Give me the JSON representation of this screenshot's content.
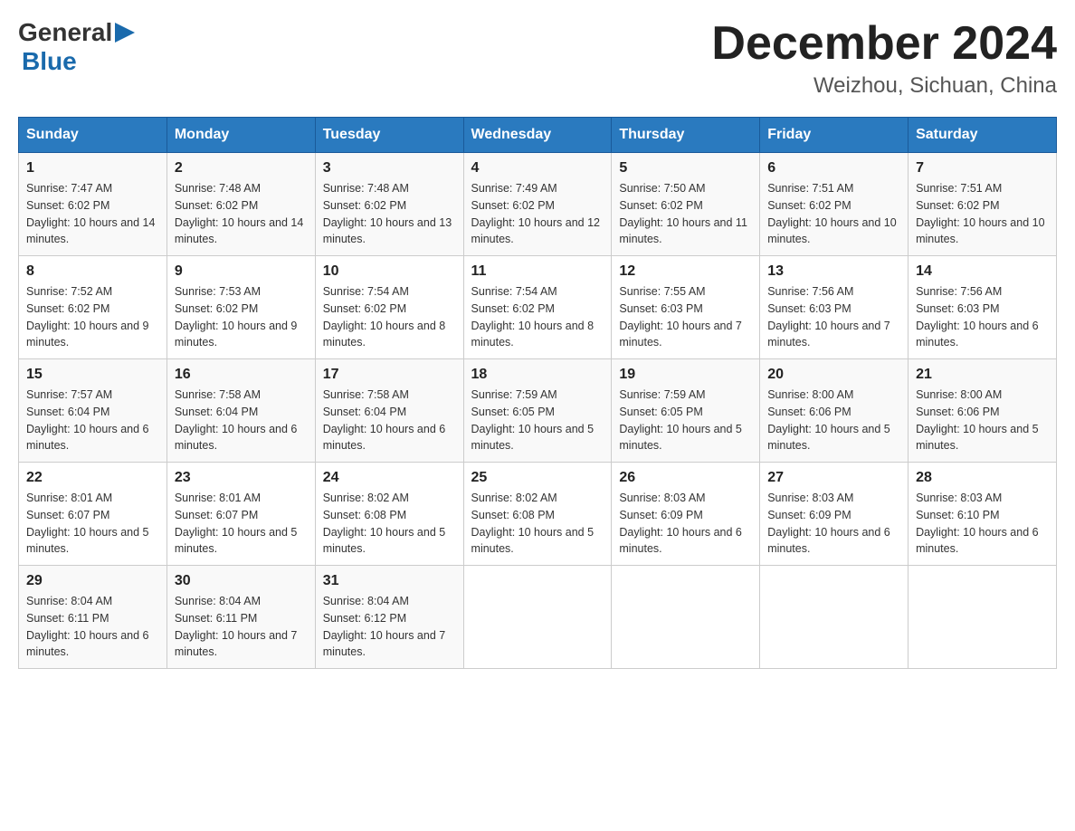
{
  "logo": {
    "text_general": "General",
    "text_blue": "Blue"
  },
  "title": {
    "month_year": "December 2024",
    "location": "Weizhou, Sichuan, China"
  },
  "headers": [
    "Sunday",
    "Monday",
    "Tuesday",
    "Wednesday",
    "Thursday",
    "Friday",
    "Saturday"
  ],
  "weeks": [
    [
      {
        "day": "1",
        "sunrise": "7:47 AM",
        "sunset": "6:02 PM",
        "daylight": "10 hours and 14 minutes."
      },
      {
        "day": "2",
        "sunrise": "7:48 AM",
        "sunset": "6:02 PM",
        "daylight": "10 hours and 14 minutes."
      },
      {
        "day": "3",
        "sunrise": "7:48 AM",
        "sunset": "6:02 PM",
        "daylight": "10 hours and 13 minutes."
      },
      {
        "day": "4",
        "sunrise": "7:49 AM",
        "sunset": "6:02 PM",
        "daylight": "10 hours and 12 minutes."
      },
      {
        "day": "5",
        "sunrise": "7:50 AM",
        "sunset": "6:02 PM",
        "daylight": "10 hours and 11 minutes."
      },
      {
        "day": "6",
        "sunrise": "7:51 AM",
        "sunset": "6:02 PM",
        "daylight": "10 hours and 10 minutes."
      },
      {
        "day": "7",
        "sunrise": "7:51 AM",
        "sunset": "6:02 PM",
        "daylight": "10 hours and 10 minutes."
      }
    ],
    [
      {
        "day": "8",
        "sunrise": "7:52 AM",
        "sunset": "6:02 PM",
        "daylight": "10 hours and 9 minutes."
      },
      {
        "day": "9",
        "sunrise": "7:53 AM",
        "sunset": "6:02 PM",
        "daylight": "10 hours and 9 minutes."
      },
      {
        "day": "10",
        "sunrise": "7:54 AM",
        "sunset": "6:02 PM",
        "daylight": "10 hours and 8 minutes."
      },
      {
        "day": "11",
        "sunrise": "7:54 AM",
        "sunset": "6:02 PM",
        "daylight": "10 hours and 8 minutes."
      },
      {
        "day": "12",
        "sunrise": "7:55 AM",
        "sunset": "6:03 PM",
        "daylight": "10 hours and 7 minutes."
      },
      {
        "day": "13",
        "sunrise": "7:56 AM",
        "sunset": "6:03 PM",
        "daylight": "10 hours and 7 minutes."
      },
      {
        "day": "14",
        "sunrise": "7:56 AM",
        "sunset": "6:03 PM",
        "daylight": "10 hours and 6 minutes."
      }
    ],
    [
      {
        "day": "15",
        "sunrise": "7:57 AM",
        "sunset": "6:04 PM",
        "daylight": "10 hours and 6 minutes."
      },
      {
        "day": "16",
        "sunrise": "7:58 AM",
        "sunset": "6:04 PM",
        "daylight": "10 hours and 6 minutes."
      },
      {
        "day": "17",
        "sunrise": "7:58 AM",
        "sunset": "6:04 PM",
        "daylight": "10 hours and 6 minutes."
      },
      {
        "day": "18",
        "sunrise": "7:59 AM",
        "sunset": "6:05 PM",
        "daylight": "10 hours and 5 minutes."
      },
      {
        "day": "19",
        "sunrise": "7:59 AM",
        "sunset": "6:05 PM",
        "daylight": "10 hours and 5 minutes."
      },
      {
        "day": "20",
        "sunrise": "8:00 AM",
        "sunset": "6:06 PM",
        "daylight": "10 hours and 5 minutes."
      },
      {
        "day": "21",
        "sunrise": "8:00 AM",
        "sunset": "6:06 PM",
        "daylight": "10 hours and 5 minutes."
      }
    ],
    [
      {
        "day": "22",
        "sunrise": "8:01 AM",
        "sunset": "6:07 PM",
        "daylight": "10 hours and 5 minutes."
      },
      {
        "day": "23",
        "sunrise": "8:01 AM",
        "sunset": "6:07 PM",
        "daylight": "10 hours and 5 minutes."
      },
      {
        "day": "24",
        "sunrise": "8:02 AM",
        "sunset": "6:08 PM",
        "daylight": "10 hours and 5 minutes."
      },
      {
        "day": "25",
        "sunrise": "8:02 AM",
        "sunset": "6:08 PM",
        "daylight": "10 hours and 5 minutes."
      },
      {
        "day": "26",
        "sunrise": "8:03 AM",
        "sunset": "6:09 PM",
        "daylight": "10 hours and 6 minutes."
      },
      {
        "day": "27",
        "sunrise": "8:03 AM",
        "sunset": "6:09 PM",
        "daylight": "10 hours and 6 minutes."
      },
      {
        "day": "28",
        "sunrise": "8:03 AM",
        "sunset": "6:10 PM",
        "daylight": "10 hours and 6 minutes."
      }
    ],
    [
      {
        "day": "29",
        "sunrise": "8:04 AM",
        "sunset": "6:11 PM",
        "daylight": "10 hours and 6 minutes."
      },
      {
        "day": "30",
        "sunrise": "8:04 AM",
        "sunset": "6:11 PM",
        "daylight": "10 hours and 7 minutes."
      },
      {
        "day": "31",
        "sunrise": "8:04 AM",
        "sunset": "6:12 PM",
        "daylight": "10 hours and 7 minutes."
      },
      null,
      null,
      null,
      null
    ]
  ]
}
